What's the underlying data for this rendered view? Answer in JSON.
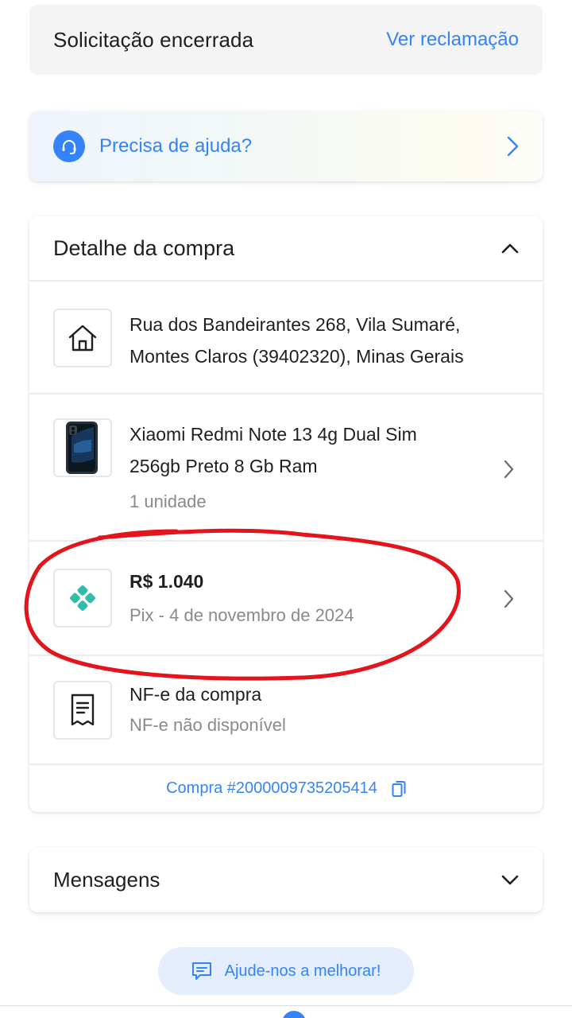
{
  "status": {
    "title": "Solicitação encerrada",
    "link": "Ver reclamação"
  },
  "help": {
    "label": "Precisa de ajuda?",
    "icon": "headset-icon"
  },
  "purchase": {
    "title": "Detalhe da compra",
    "address": {
      "line1": "Rua dos Bandeirantes 268, Vila Sumaré,",
      "line2": "Montes Claros (39402320), Minas Gerais",
      "icon": "home-icon"
    },
    "product": {
      "name_line1": "Xiaomi Redmi Note 13 4g Dual Sim",
      "name_line2": "256gb Preto 8 Gb Ram",
      "quantity": "1 unidade",
      "icon": "phone-thumbnail"
    },
    "payment": {
      "amount": "R$ 1.040",
      "detail": "Pix - 4 de novembro de 2024",
      "icon": "pix-icon",
      "icon_color": "#32bcad"
    },
    "invoice": {
      "title": "NF-e da compra",
      "status": "NF-e não disponível",
      "icon": "receipt-icon"
    },
    "order_number": "Compra #2000009735205414"
  },
  "messages": {
    "title": "Mensagens"
  },
  "feedback": {
    "label": "Ajude-nos a melhorar!"
  },
  "colors": {
    "accent": "#3483fa",
    "annotation": "#e3141b"
  }
}
